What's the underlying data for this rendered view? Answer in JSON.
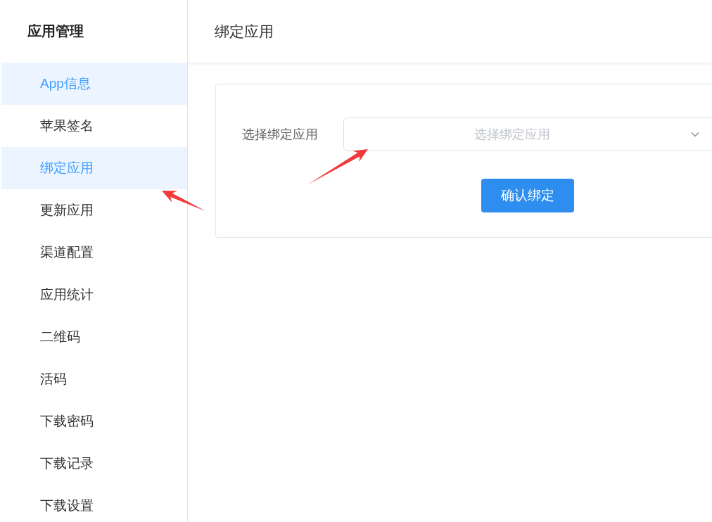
{
  "sidebar": {
    "title": "应用管理",
    "items": [
      {
        "label": "App信息",
        "selected": true
      },
      {
        "label": "苹果签名",
        "selected": false
      },
      {
        "label": "绑定应用",
        "selected": true
      },
      {
        "label": "更新应用",
        "selected": false
      },
      {
        "label": "渠道配置",
        "selected": false
      },
      {
        "label": "应用统计",
        "selected": false
      },
      {
        "label": "二维码",
        "selected": false
      },
      {
        "label": "活码",
        "selected": false
      },
      {
        "label": "下载密码",
        "selected": false
      },
      {
        "label": "下载记录",
        "selected": false
      },
      {
        "label": "下载设置",
        "selected": false
      }
    ]
  },
  "header": {
    "title": "绑定应用"
  },
  "form": {
    "label": "选择绑定应用",
    "select": {
      "placeholder": "选择绑定应用"
    },
    "button": "确认绑定"
  }
}
